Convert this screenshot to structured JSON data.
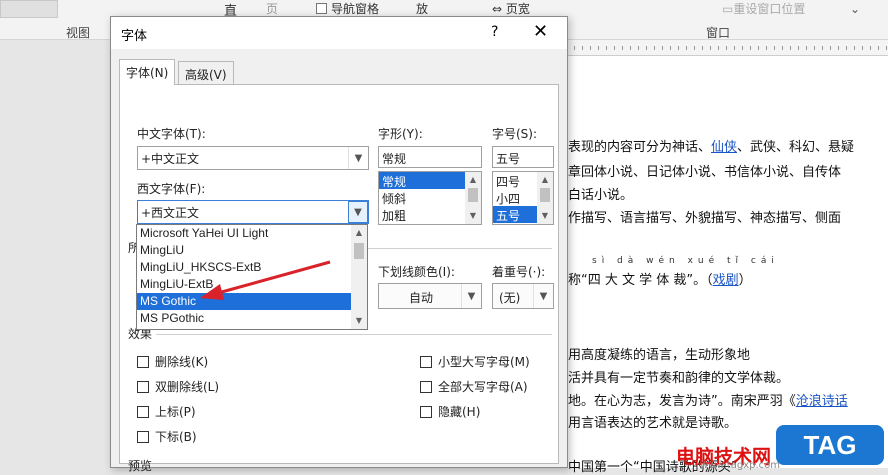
{
  "ribbon": {
    "view_group": "视图",
    "window_group": "窗口",
    "page_partial": "页",
    "nav_pane": "导航窗格",
    "zoom_partial": "放",
    "page_width": "页宽",
    "reset_window": "重设窗口位置",
    "straight_partial": "直"
  },
  "dialog": {
    "title": "字体",
    "help": "?",
    "close": "✕",
    "tabs": [
      "字体(N)",
      "高级(V)"
    ],
    "chinese_font_label": "中文字体(T):",
    "chinese_font_value": "+中文正文",
    "western_font_label": "西文字体(F):",
    "western_font_value": "+西文正文",
    "style_label": "字形(Y):",
    "style_value": "常规",
    "style_items": [
      "常规",
      "倾斜",
      "加粗"
    ],
    "size_label": "字号(S):",
    "size_value": "五号",
    "size_items": [
      "四号",
      "小四",
      "五号"
    ],
    "all_text_partial": "所",
    "underline_color_label": "下划线颜色(I):",
    "underline_color_value": "自动",
    "emphasis_label": "着重号(·):",
    "emphasis_value": "(无)",
    "effects_label": "效果",
    "effects_left": [
      "删除线(K)",
      "双删除线(L)",
      "上标(P)",
      "下标(B)"
    ],
    "effects_right": [
      "小型大写字母(M)",
      "全部大写字母(A)",
      "隐藏(H)"
    ],
    "preview_partial": "预览",
    "font_dropdown": [
      "Microsoft YaHei UI Light",
      "MingLiU",
      "MingLiU_HKSCS-ExtB",
      "MingLiU-ExtB",
      "MS Gothic",
      "MS PGothic"
    ],
    "font_dropdown_selected_index": 4
  },
  "document": {
    "lines": [
      {
        "text": "表现的内容可分为神话、",
        "link": "仙侠",
        "tail": "、武侠、科幻、悬疑"
      },
      {
        "text": "章回体小说、日记体小说、书信体小说、自传体"
      },
      {
        "text": "白话小说。"
      },
      {
        "text": "作描写、语言描写、外貌描写、神态描写、侧面"
      },
      {
        "text": "称“四 大 文 学 体 裁”。（",
        "link": "戏剧",
        "tail": "）"
      },
      {
        "text": "用高度凝练的语言，生动形象地"
      },
      {
        "text": "活并具有一定节奏和韵律的文学体裁。"
      },
      {
        "text": "地。在心为志，发言为诗”。南宋严羽《",
        "link": "沧浪诗话"
      },
      {
        "text": "用言语表达的艺术就是诗歌。"
      },
      {
        "text": "中国第一个“中国诗歌的源头”"
      }
    ],
    "pinyin": "sì dà wén xué tǐ cái",
    "watermark_site": "电脑技术网",
    "watermark_url": "www.tagxp.com",
    "tag_badge": "TAG"
  },
  "colors": {
    "selection": "#1e6fd9",
    "link": "#1a55c5",
    "arrow": "#d9222a",
    "tag_badge": "#1b77d2"
  }
}
